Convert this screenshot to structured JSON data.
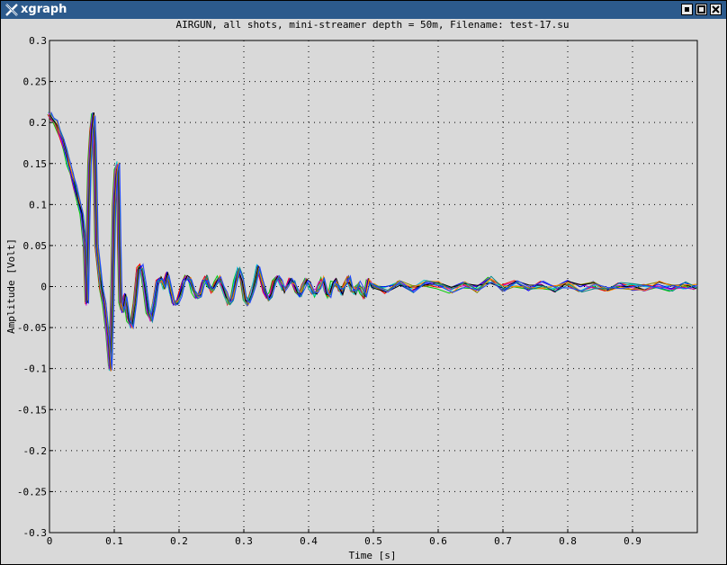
{
  "window": {
    "title": "xgraph"
  },
  "chart_data": {
    "type": "line",
    "title": "AIRGUN, all shots, mini-streamer depth = 50m, Filename: test-17.su",
    "xlabel": "Time [s]",
    "ylabel": "Amplitude [Volt]",
    "xlim": [
      0,
      1.0
    ],
    "ylim": [
      -0.3,
      0.3
    ],
    "x_ticks": [
      0,
      0.1,
      0.2,
      0.3,
      0.4,
      0.5,
      0.6,
      0.7,
      0.8,
      0.9
    ],
    "x_tick_labels": [
      "0",
      "0.1",
      "0.2",
      "0.3",
      "0.4",
      "0.5",
      "0.6",
      "0.7",
      "0.8",
      "0.9"
    ],
    "y_ticks": [
      0.3,
      0.25,
      0.2,
      0.15,
      0.1,
      0.05,
      0,
      -0.05,
      -0.1,
      -0.15,
      -0.2,
      -0.25,
      -0.3
    ],
    "y_tick_labels": [
      "0.3",
      "0.25",
      "0.2",
      "0.15",
      "0.1",
      "0.05",
      "0",
      "-0.05",
      "-0.1",
      "-0.15",
      "-0.2",
      "-0.25",
      "-0.3"
    ],
    "grid": true,
    "series_colors": [
      "#00cc00",
      "#ff0000",
      "#00cccc",
      "#cc00cc",
      "#0000ff",
      "#888800",
      "#000000",
      "#ff8800",
      "#008888",
      "#2244ff"
    ],
    "series": [
      {
        "x": [
          0,
          0.005,
          0.01,
          0.015,
          0.02,
          0.025,
          0.03,
          0.035,
          0.04,
          0.045,
          0.05,
          0.055,
          0.058,
          0.06,
          0.062,
          0.065,
          0.068,
          0.07,
          0.073,
          0.077,
          0.08,
          0.085,
          0.09,
          0.094,
          0.097,
          0.1,
          0.103,
          0.106,
          0.108,
          0.11,
          0.113,
          0.117,
          0.122,
          0.127,
          0.132,
          0.137,
          0.142,
          0.147,
          0.152,
          0.157,
          0.162,
          0.167,
          0.172,
          0.177,
          0.182,
          0.187,
          0.192,
          0.197,
          0.202,
          0.207,
          0.212,
          0.217,
          0.222,
          0.227,
          0.232,
          0.237,
          0.242,
          0.247,
          0.252,
          0.257,
          0.262,
          0.267,
          0.272,
          0.277,
          0.282,
          0.287,
          0.292,
          0.297,
          0.302,
          0.307,
          0.312,
          0.317,
          0.322,
          0.327,
          0.332,
          0.337,
          0.342,
          0.347,
          0.352,
          0.357,
          0.362,
          0.367,
          0.372,
          0.377,
          0.382,
          0.387,
          0.392,
          0.397,
          0.402,
          0.407,
          0.412,
          0.417,
          0.422,
          0.427,
          0.432,
          0.437,
          0.442,
          0.447,
          0.452,
          0.457,
          0.462,
          0.467,
          0.472,
          0.477,
          0.482,
          0.487,
          0.492,
          0.497,
          0.5,
          0.52,
          0.54,
          0.56,
          0.58,
          0.6,
          0.62,
          0.64,
          0.66,
          0.68,
          0.7,
          0.72,
          0.74,
          0.76,
          0.78,
          0.8,
          0.82,
          0.84,
          0.86,
          0.88,
          0.9,
          0.92,
          0.94,
          0.96,
          0.98,
          0.998
        ],
        "y": [
          0.21,
          0.205,
          0.2,
          0.19,
          0.18,
          0.165,
          0.15,
          0.135,
          0.12,
          0.105,
          0.09,
          0.05,
          -0.02,
          0.08,
          0.15,
          0.19,
          0.21,
          0.17,
          0.05,
          0.02,
          0.0,
          -0.02,
          -0.06,
          -0.1,
          -0.02,
          0.1,
          0.14,
          0.15,
          0.05,
          -0.02,
          -0.03,
          -0.01,
          -0.04,
          -0.05,
          -0.02,
          0.02,
          0.025,
          0.0,
          -0.03,
          -0.04,
          -0.02,
          0.005,
          0.01,
          0.0,
          0.015,
          -0.005,
          -0.02,
          -0.02,
          -0.01,
          0.005,
          0.012,
          0.008,
          -0.005,
          -0.012,
          -0.01,
          0.005,
          0.01,
          0.0,
          -0.005,
          0.005,
          0.01,
          0.002,
          -0.01,
          -0.02,
          -0.015,
          0.005,
          0.02,
          0.01,
          -0.015,
          -0.02,
          -0.01,
          0.005,
          0.025,
          0.01,
          -0.005,
          -0.015,
          -0.01,
          0.005,
          0.01,
          0.005,
          -0.005,
          0.0,
          0.008,
          0.005,
          -0.005,
          -0.01,
          0.0,
          0.008,
          0.002,
          -0.006,
          -0.008,
          0.002,
          0.01,
          -0.005,
          -0.01,
          0.002,
          0.006,
          -0.004,
          -0.006,
          0.004,
          0.008,
          -0.002,
          -0.006,
          0.004,
          -0.004,
          -0.01,
          0.006,
          0.002,
          0.0,
          -0.004,
          0.006,
          -0.003,
          0.004,
          0.002,
          -0.004,
          0.003,
          -0.003,
          0.008,
          -0.002,
          0.003,
          -0.003,
          0.002,
          -0.002,
          0.003,
          -0.002,
          0.002,
          -0.002,
          0.002,
          0.0,
          -0.002,
          0.002,
          -0.001,
          0.001,
          0.0
        ]
      }
    ]
  }
}
